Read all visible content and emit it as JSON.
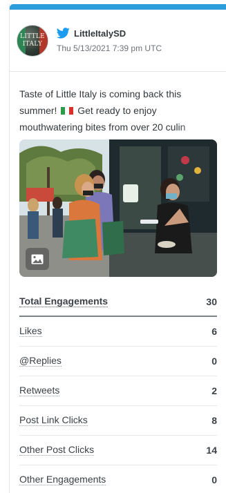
{
  "account": {
    "handle": "LittleItalySD",
    "timestamp": "Thu 5/13/2021 7:39 pm UTC",
    "avatar_text_line1": "LITTLE",
    "avatar_text_line2": "ITALY"
  },
  "post": {
    "text": "Taste of Little Italy is coming back this summer! 🇮🇹 Get ready to enjoy mouthwatering bites from over 20 culin",
    "text_line1": "Taste of Little Italy is coming back this",
    "text_line2_before": "summer!",
    "text_line2_after": "Get ready to enjoy",
    "text_line3": "mouthwatering bites from over 20 culin",
    "flag_colors": [
      "#2e9b48",
      "#ffffff",
      "#d8312a"
    ],
    "media_icon": "image-icon"
  },
  "stats": [
    {
      "label": "Total Engagements",
      "value": "30"
    },
    {
      "label": "Likes",
      "value": "6"
    },
    {
      "label": "@Replies",
      "value": "0"
    },
    {
      "label": "Retweets",
      "value": "2"
    },
    {
      "label": "Post Link Clicks",
      "value": "8"
    },
    {
      "label": "Other Post Clicks",
      "value": "14"
    },
    {
      "label": "Other Engagements",
      "value": "0"
    }
  ],
  "colors": {
    "accent_bar": "#2d9cdb",
    "twitter_blue": "#1d9bf0"
  }
}
